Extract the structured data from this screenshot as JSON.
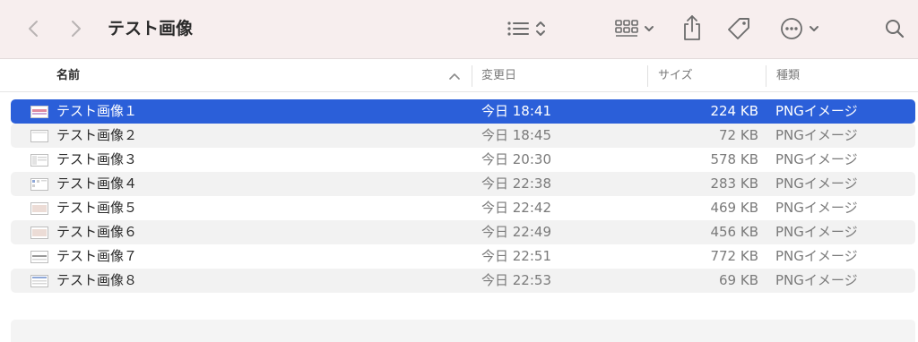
{
  "window": {
    "title": "テスト画像"
  },
  "columns": {
    "name": "名前",
    "date": "変更日",
    "size": "サイズ",
    "kind": "種類"
  },
  "files": [
    {
      "name": "テスト画像１",
      "date": "今日 18:41",
      "size": "224 KB",
      "kind": "PNGイメージ"
    },
    {
      "name": "テスト画像２",
      "date": "今日 18:45",
      "size": "72 KB",
      "kind": "PNGイメージ"
    },
    {
      "name": "テスト画像３",
      "date": "今日 20:30",
      "size": "578 KB",
      "kind": "PNGイメージ"
    },
    {
      "name": "テスト画像４",
      "date": "今日 22:38",
      "size": "283 KB",
      "kind": "PNGイメージ"
    },
    {
      "name": "テスト画像５",
      "date": "今日 22:42",
      "size": "469 KB",
      "kind": "PNGイメージ"
    },
    {
      "name": "テスト画像６",
      "date": "今日 22:49",
      "size": "456 KB",
      "kind": "PNGイメージ"
    },
    {
      "name": "テスト画像７",
      "date": "今日 22:51",
      "size": "772 KB",
      "kind": "PNGイメージ"
    },
    {
      "name": "テスト画像８",
      "date": "今日 22:53",
      "size": "69 KB",
      "kind": "PNGイメージ"
    }
  ],
  "colors": {
    "toolbar_bg": "#f7eeee",
    "selection": "#2b5fd9",
    "stripe": "#f2f2f2",
    "icon_gray": "#6d6d6d"
  },
  "icons": {
    "back": "chevron-left-icon",
    "forward": "chevron-right-icon",
    "list_view": "list-view-icon",
    "grid_view": "grid-view-icon",
    "share": "share-icon",
    "tag": "tag-icon",
    "more": "ellipsis-circle-icon",
    "search": "search-icon",
    "file": "png-file-icon"
  }
}
